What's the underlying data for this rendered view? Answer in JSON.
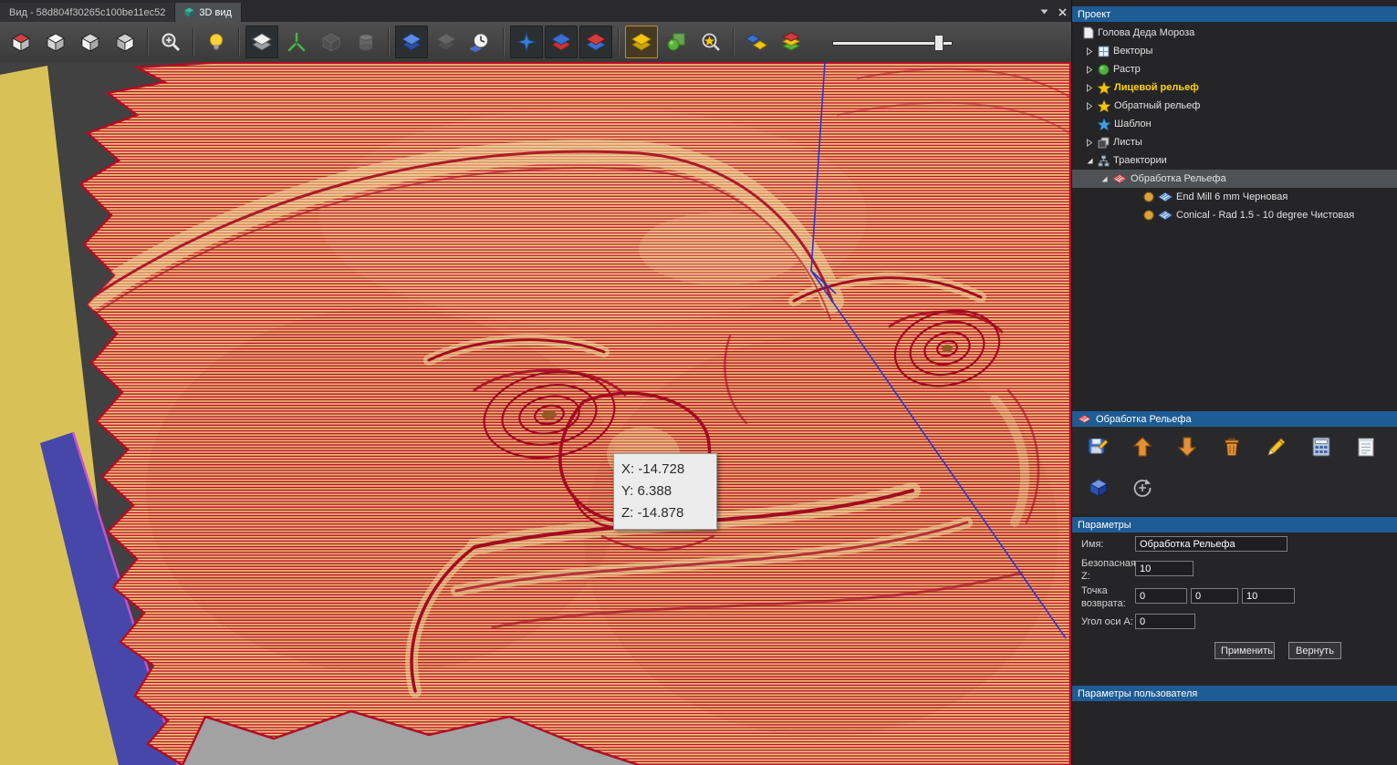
{
  "tabs": {
    "view_tab_label": "Вид - 58d804f30265c100be11ec52",
    "active_tab_label": "3D вид"
  },
  "toolbar_icons": [
    "iso-view",
    "front-view",
    "left-view",
    "right-view",
    "zoom-in",
    "light-toggle",
    "relief-view",
    "axes-toggle",
    "block-view",
    "cylinder-view",
    "material-blue",
    "material-gray",
    "simulation-time",
    "sparkle-toggle",
    "layers-blue-red",
    "layers-red-blue",
    "active-layer-yellow",
    "raster-sphere",
    "find-layer",
    "diamond-blue-yellow",
    "layers-red-green-yellow",
    "shade-slider"
  ],
  "viewport": {
    "tooltip": {
      "x": "X: -14.728",
      "y": "Y: 6.388",
      "z": "Z: -14.878"
    }
  },
  "project": {
    "title": "Проект",
    "items": [
      {
        "label": "Голова Деда Мороза"
      },
      {
        "label": "Векторы"
      },
      {
        "label": "Растр"
      },
      {
        "label": "Лицевой рельеф",
        "highlighted": true
      },
      {
        "label": "Обратный рельеф"
      },
      {
        "label": "Шаблон"
      },
      {
        "label": "Листы"
      },
      {
        "label": "Траектории"
      },
      {
        "label": "Обработка Рельефа",
        "selected": true
      },
      {
        "label": "End Mill 6 mm Черновая"
      },
      {
        "label": "Conical - Rad 1.5 - 10 degree Чистовая"
      }
    ]
  },
  "machining": {
    "title": "Обработка Рельефа",
    "icons": [
      "save-edit",
      "move-up",
      "move-down",
      "delete",
      "edit",
      "calculate",
      "notes",
      "simulate",
      "transform"
    ]
  },
  "parameters": {
    "title": "Параметры",
    "name_label": "Имя:",
    "name_value": "Обработка Рельефа",
    "safe_z_label": "Безопасная Z:",
    "safe_z_value": "10",
    "return_label": "Точка возврата:",
    "return_x": "0",
    "return_y": "0",
    "return_z": "10",
    "a_angle_label": "Угол оси A:",
    "a_angle_value": "0",
    "apply_label": "Применить",
    "revert_label": "Вернуть"
  },
  "user_parameters": {
    "title": "Параметры пользователя"
  },
  "colors": {
    "header_blue": "#1d5c95",
    "highlight_yellow": "#ffd400",
    "toolpath_red": "#c31229",
    "relief_tan": "#e9c87e",
    "base_yellow": "#d8c258",
    "side_blue": "#4747aa"
  }
}
